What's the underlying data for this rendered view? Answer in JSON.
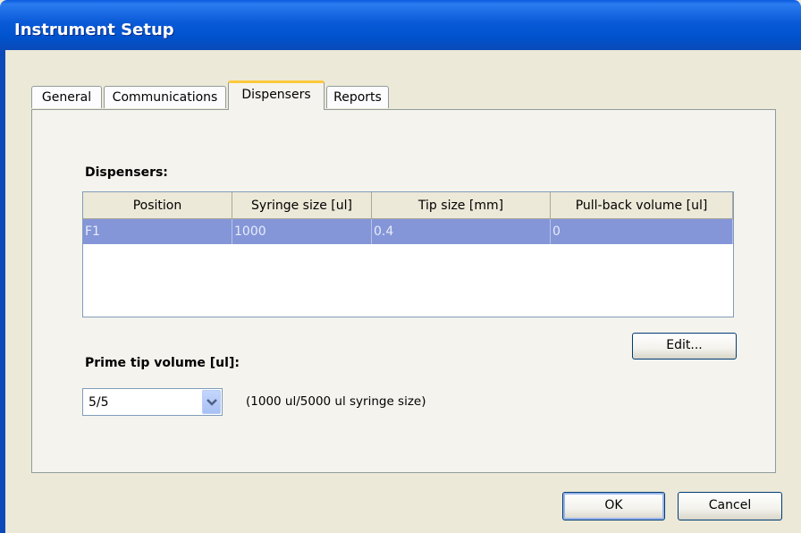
{
  "window": {
    "title": "Instrument Setup"
  },
  "tabs": [
    {
      "label": "General"
    },
    {
      "label": "Communications"
    },
    {
      "label": "Dispensers"
    },
    {
      "label": "Reports"
    }
  ],
  "dispensers": {
    "section_label": "Dispensers:",
    "columns": [
      "Position",
      "Syringe size [ul]",
      "Tip size [mm]",
      "Pull-back volume [ul]"
    ],
    "rows": [
      [
        "F1",
        "1000",
        "0.4",
        "0"
      ]
    ],
    "edit_button": "Edit..."
  },
  "prime": {
    "label": "Prime tip volume [ul]:",
    "selected": "5/5",
    "note": "(1000 ul/5000 ul syringe size)"
  },
  "footer": {
    "ok": "OK",
    "cancel": "Cancel"
  },
  "colors": {
    "titlebar": "#0052cc",
    "selected_row": "#8496d8",
    "active_tab_accent": "#ffc83c"
  }
}
